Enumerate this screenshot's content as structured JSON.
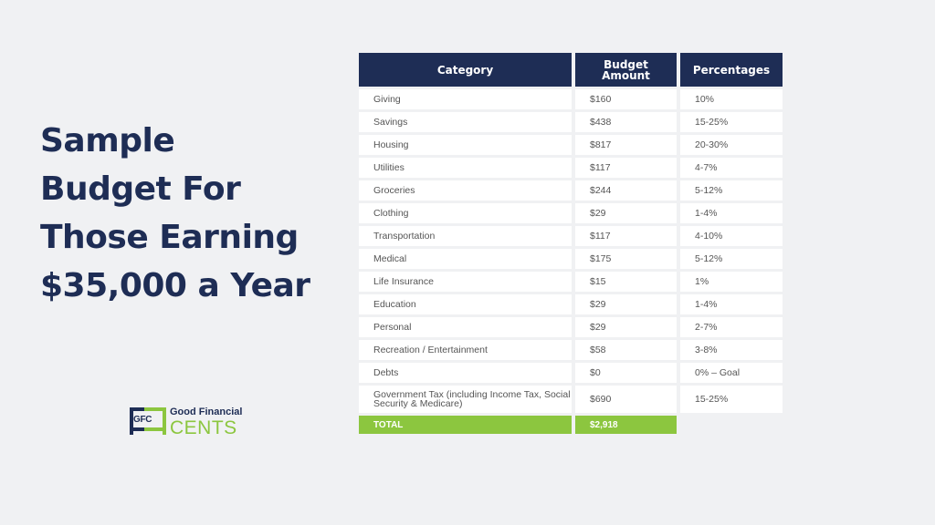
{
  "title_lines": [
    "Sample",
    "Budget For",
    "Those Earning",
    "$35,000 a Year"
  ],
  "logo": {
    "mark": "GFC",
    "line1": "Good Financial",
    "line2": "CENTS"
  },
  "table": {
    "headers": [
      "Category",
      "Budget Amount",
      "Percentages"
    ],
    "rows": [
      [
        "Giving",
        "$160",
        "10%"
      ],
      [
        "Savings",
        "$438",
        "15-25%"
      ],
      [
        "Housing",
        "$817",
        "20-30%"
      ],
      [
        "Utilities",
        "$117",
        "4-7%"
      ],
      [
        "Groceries",
        "$244",
        "5-12%"
      ],
      [
        "Clothing",
        "$29",
        "1-4%"
      ],
      [
        "Transportation",
        "$117",
        "4-10%"
      ],
      [
        "Medical",
        "$175",
        "5-12%"
      ],
      [
        "Life Insurance",
        "$15",
        "1%"
      ],
      [
        "Education",
        "$29",
        "1-4%"
      ],
      [
        "Personal",
        "$29",
        "2-7%"
      ],
      [
        "Recreation / Entertainment",
        "$58",
        "3-8%"
      ],
      [
        "Debts",
        "$0",
        "0% – Goal"
      ],
      [
        "Government Tax (including Income Tax, Social Security & Medicare)",
        "$690",
        "15-25%"
      ]
    ],
    "total": {
      "label": "TOTAL",
      "amount": "$2,918"
    }
  },
  "colors": {
    "navy": "#1e2d55",
    "green": "#8cc63f",
    "background": "#f0f1f3"
  }
}
